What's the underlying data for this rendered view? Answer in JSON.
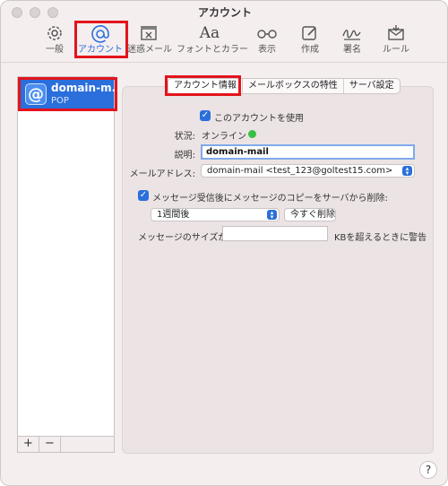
{
  "window": {
    "title": "アカウント"
  },
  "toolbar": {
    "items": [
      {
        "label": "一般",
        "icon": "gear-icon"
      },
      {
        "label": "アカウント",
        "icon": "at-icon",
        "active": true
      },
      {
        "label": "迷惑メール",
        "icon": "junk-mail-icon"
      },
      {
        "label": "フォントとカラー",
        "icon": "fonts-colors-icon",
        "glyph": "Aa"
      },
      {
        "label": "表示",
        "icon": "glasses-icon"
      },
      {
        "label": "作成",
        "icon": "compose-icon"
      },
      {
        "label": "署名",
        "icon": "signature-icon"
      },
      {
        "label": "ルール",
        "icon": "rules-icon"
      }
    ],
    "accent_color": "#2a6fdb"
  },
  "accounts": [
    {
      "name": "domain-m...",
      "type": "POP",
      "icon_glyph": "@"
    }
  ],
  "list_footer": {
    "add": "+",
    "remove": "−"
  },
  "tabs": [
    {
      "label": "アカウント情報",
      "active": true
    },
    {
      "label": "メールボックスの特性"
    },
    {
      "label": "サーバ設定"
    }
  ],
  "account_info": {
    "enable_label": "このアカウントを使用",
    "enable_checked": true,
    "status_label": "状況:",
    "status_value": "オンライン",
    "status_color": "#35c246",
    "description_label": "説明:",
    "description_value": "domain-mail",
    "email_label": "メールアドレス:",
    "email_value": "domain-mail <test_123@goltest15.com>",
    "remove_copy_label": "メッセージ受信後にメッセージのコピーをサーバから削除:",
    "remove_copy_checked": true,
    "remove_after_value": "1週間後",
    "remove_now_button": "今すぐ削除",
    "size_label": "メッセージのサイズが",
    "size_value": "",
    "size_suffix": "KBを超えるときに警告"
  },
  "help_glyph": "?"
}
